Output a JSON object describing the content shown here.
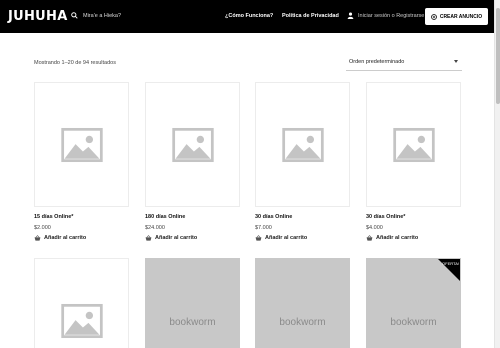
{
  "header": {
    "logo": "JUHUHA",
    "search_placeholder": "Mira'e a Hieka?",
    "nav": [
      "¿Cómo Funciona?",
      "Política de Privacidad"
    ],
    "login": "Iniciar sesión o Registrarse",
    "cta": "CREAR ANUNCIO"
  },
  "toolbar": {
    "results": "Mostrando 1–20 de 94 resultados",
    "sort": "Orden predeterminado"
  },
  "products": [
    {
      "title": "15 días Online*",
      "price": "$2.000",
      "cart": "Añadir al carrito",
      "image": "placeholder"
    },
    {
      "title": "180 días Online",
      "price": "$24.000",
      "cart": "Añadir al carrito",
      "image": "placeholder"
    },
    {
      "title": "30 días Online",
      "price": "$7.000",
      "cart": "Añadir al carrito",
      "image": "placeholder"
    },
    {
      "title": "30 días Online*",
      "price": "$4.000",
      "cart": "Añadir al carrito",
      "image": "placeholder"
    }
  ],
  "second_row": [
    {
      "image": "placeholder",
      "text": ""
    },
    {
      "image": "bookworm",
      "text": "bookworm"
    },
    {
      "image": "bookworm",
      "text": "bookworm"
    },
    {
      "image": "bookworm",
      "text": "bookworm",
      "badge": "OFERTA!"
    }
  ]
}
